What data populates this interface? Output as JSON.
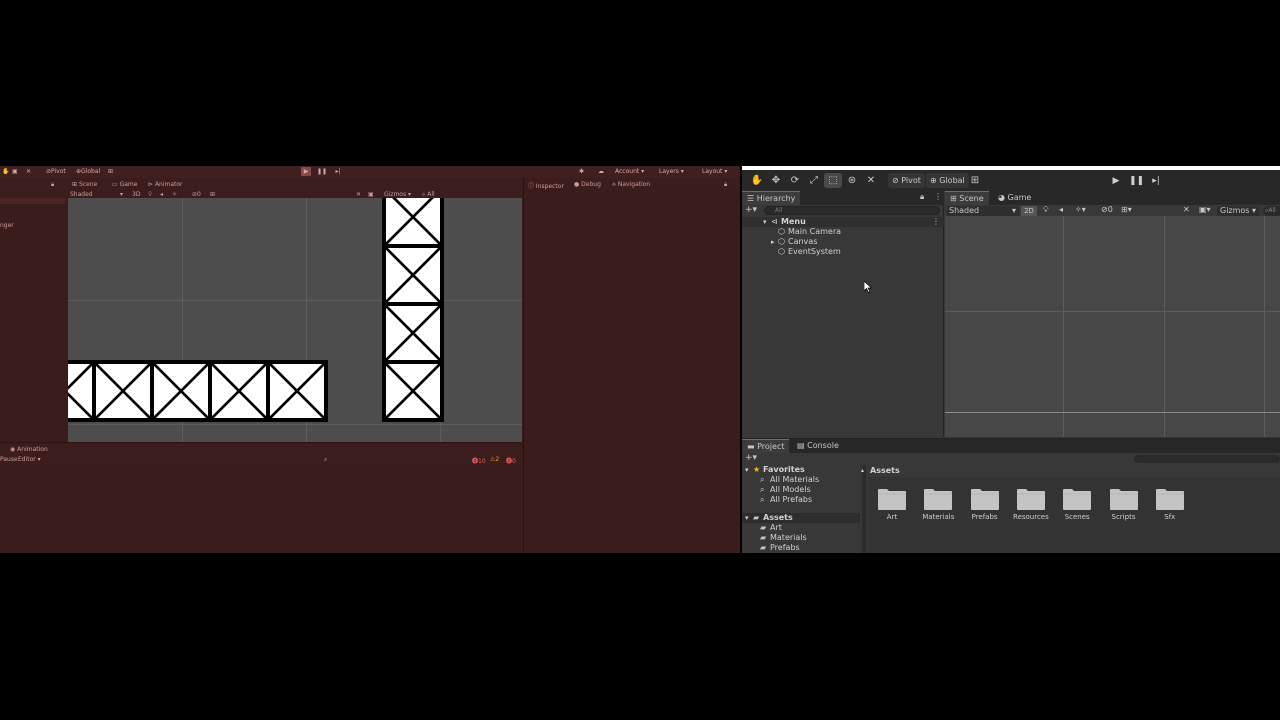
{
  "left_editor": {
    "toolbar": {
      "pivot": "Pivot",
      "global": "Global",
      "account": "Account",
      "layers": "Layers",
      "layout": "Layout"
    },
    "tabs": {
      "scene": "Scene",
      "game": "Game",
      "animator": "Animator"
    },
    "scene_bar": {
      "shaded": "Shaded",
      "gizmos": "Gizmos",
      "search": "All",
      "hidden_count": "0"
    },
    "inspector_tabs": {
      "inspector": "Inspector",
      "debug": "Debug",
      "navigation": "Navigation"
    },
    "animation": {
      "tab": "Animation",
      "pause": "Pause",
      "editor": "Editor",
      "errors": "10",
      "warnings": "2",
      "messages": "0"
    },
    "hier_fragment": "nger",
    "colors": {
      "play_tint": "#3a1c1c",
      "scene_bg": "#4d4d4d"
    }
  },
  "right_editor": {
    "toolbar": {
      "pivot": "Pivot",
      "global": "Global"
    },
    "hierarchy": {
      "tab": "Hierarchy",
      "search_placeholder": "All",
      "items": [
        {
          "label": "Menu"
        },
        {
          "label": "Main Camera"
        },
        {
          "label": "Canvas"
        },
        {
          "label": "EventSystem"
        }
      ]
    },
    "scene": {
      "tabs": {
        "scene": "Scene",
        "game": "Game"
      },
      "shaded": "Shaded",
      "mode_2d": "2D",
      "gizmos": "Gizmos",
      "hidden_count": "0",
      "search": "All"
    },
    "project": {
      "tabs": {
        "project": "Project",
        "console": "Console"
      },
      "favorites": {
        "label": "Favorites",
        "items": [
          "All Materials",
          "All Models",
          "All Prefabs"
        ]
      },
      "assets_tree": {
        "label": "Assets",
        "items": [
          "Art",
          "Materials",
          "Prefabs"
        ]
      },
      "breadcrumb": "Assets",
      "folders": [
        "Art",
        "Materials",
        "Prefabs",
        "Resources",
        "Scenes",
        "Scripts",
        "Sfx"
      ]
    },
    "colors": {
      "panel": "#383838",
      "toolbar": "#282828",
      "accent": "#3a79bb",
      "folder": "#c4c4c4"
    }
  }
}
